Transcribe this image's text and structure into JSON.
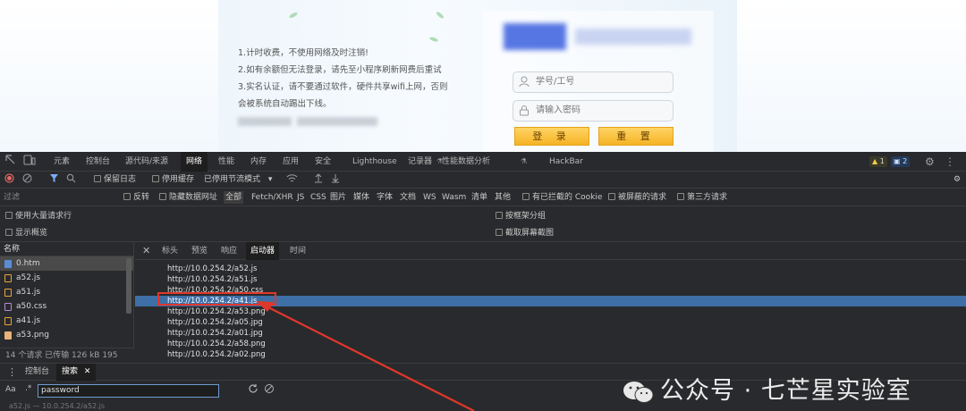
{
  "login_page": {
    "notice_lines": [
      "1.计时收费，不使用网络及时注销!",
      "2.如有余额但无法登录，请先至小程序刷新网费后重试",
      "3.实名认证，请不要通过软件，硬件共享wifi上网，否则",
      "会被系统自动踢出下线。"
    ],
    "username_placeholder": "学号/工号",
    "password_placeholder": "请输入密码",
    "login_label": "登 录",
    "reset_label": "重 置"
  },
  "devtools": {
    "tabs": [
      "元素",
      "控制台",
      "源代码/来源",
      "网络",
      "性能",
      "内存",
      "应用",
      "安全",
      "Lighthouse",
      "记录器",
      "性能数据分析",
      "HackBar"
    ],
    "active_tab": "网络",
    "warn_count": "1",
    "message_count": "2",
    "toolbar": {
      "preserve_log": "保留日志",
      "disable_cache": "停用缓存",
      "throttling": "已停用节流模式"
    },
    "filter": {
      "placeholder": "过滤",
      "invert": "反转",
      "hide_data_urls": "隐藏数据网址",
      "types": [
        "全部",
        "Fetch/XHR",
        "JS",
        "CSS",
        "图片",
        "媒体",
        "字体",
        "文档",
        "WS",
        "Wasm",
        "清单",
        "其他"
      ],
      "active_type": "全部",
      "blocked_cookies": "有已拦截的 Cookie",
      "blocked_requests": "被屏蔽的请求",
      "third_party": "第三方请求"
    },
    "options": {
      "big_rows": "使用大量请求行",
      "overview": "显示概览",
      "group_by_frame": "按框架分组",
      "capture_screenshots": "截取屏幕截图"
    },
    "request_list": {
      "header": "名称",
      "items": [
        {
          "name": "0.htm",
          "type": "doc"
        },
        {
          "name": "a52.js",
          "type": "js"
        },
        {
          "name": "a51.js",
          "type": "js"
        },
        {
          "name": "a50.css",
          "type": "css"
        },
        {
          "name": "a41.js",
          "type": "js"
        },
        {
          "name": "a53.png",
          "type": "img"
        }
      ],
      "selected": "0.htm",
      "status": "14 个请求   已传输 126 kB   195"
    },
    "detail_tabs": [
      "标头",
      "预览",
      "响应",
      "启动器",
      "时间"
    ],
    "active_detail_tab": "启动器",
    "initiator_rows": [
      "http://10.0.254.2/a52.js",
      "http://10.0.254.2/a51.js",
      "http://10.0.254.2/a50.css",
      "http://10.0.254.2/a41.js",
      "http://10.0.254.2/a53.png",
      "http://10.0.254.2/a05.jpg",
      "http://10.0.254.2/a01.jpg",
      "http://10.0.254.2/a58.png",
      "http://10.0.254.2/a02.png"
    ],
    "selected_initiator": "http://10.0.254.2/a41.js",
    "drawer": {
      "tabs": [
        "控制台",
        "搜索"
      ],
      "active": "搜索",
      "match_case": "Aa",
      "regex": ".*",
      "search_value": "password",
      "result_preview": "a52.js — 10.0.254.2/a52.js"
    }
  },
  "watermark": "公众号 · 七芒星实验室",
  "colors": {
    "accent_blue": "#3e6fa6",
    "annotation_red": "#e0372b",
    "button_yellow": "#f6b324"
  }
}
